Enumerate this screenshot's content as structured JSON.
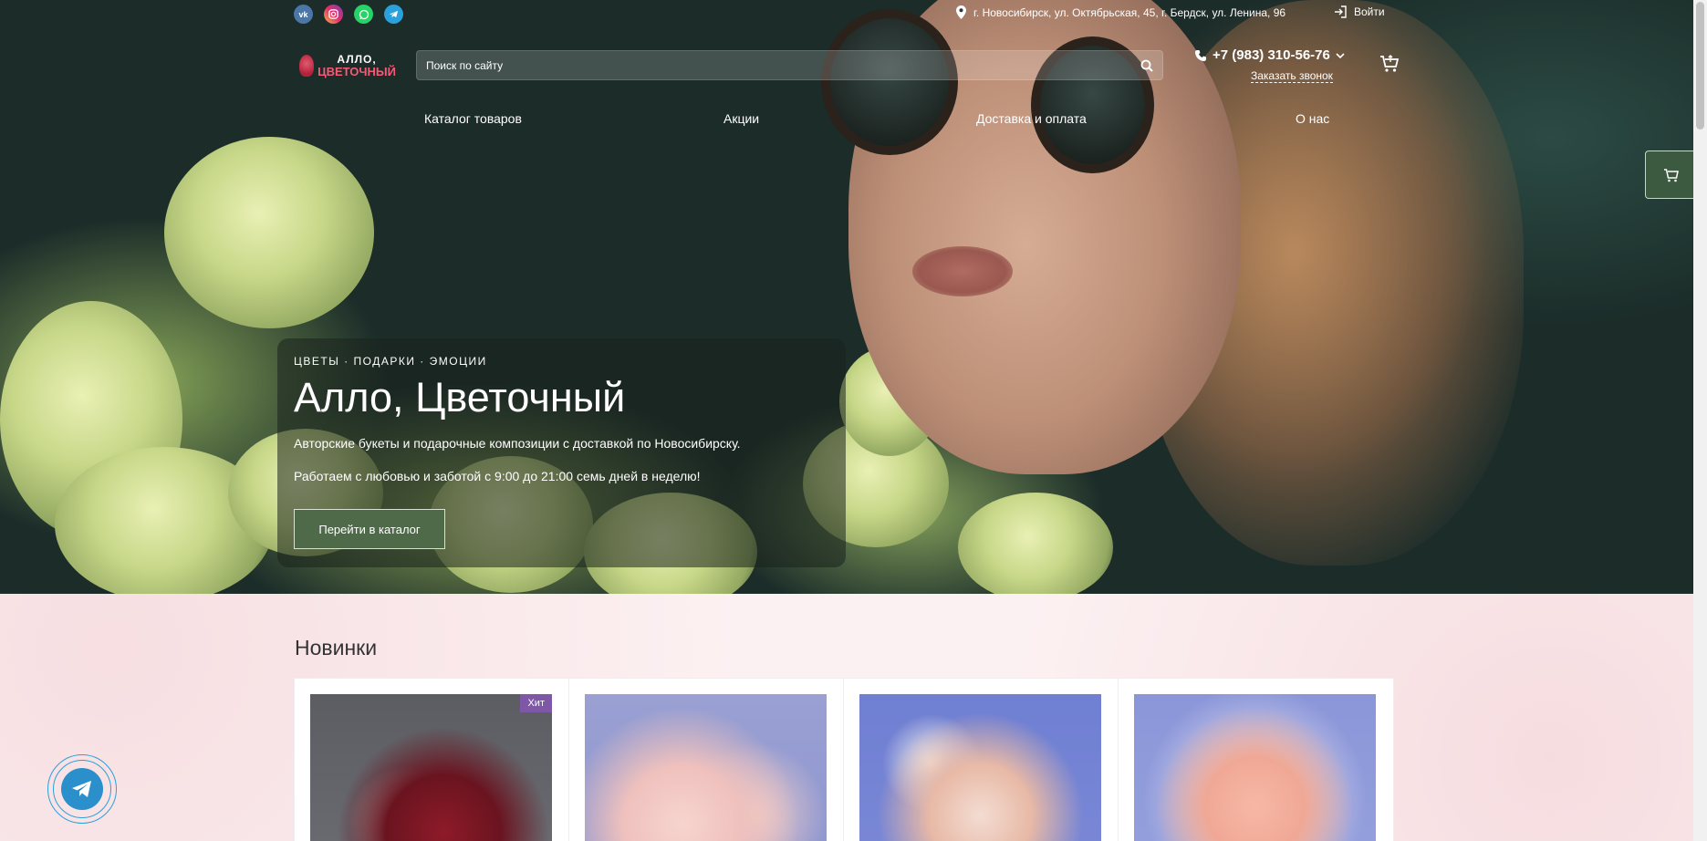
{
  "social": [
    {
      "name": "vk",
      "label": "vk"
    },
    {
      "name": "instagram",
      "label": ""
    },
    {
      "name": "whatsapp",
      "label": ""
    },
    {
      "name": "telegram",
      "label": ""
    }
  ],
  "topbar": {
    "address": "г. Новосибирск, ул. Октябрьская, 45, г. Бердск, ул. Ленина, 96",
    "login": "Войти"
  },
  "logo": {
    "line1": "АЛЛО,",
    "line2": "ЦВЕТОЧНЫЙ"
  },
  "search": {
    "placeholder": "Поиск по сайту"
  },
  "contact": {
    "phone": "+7 (983) 310-56-76",
    "callback": "Заказать звонок"
  },
  "nav": [
    "Каталог товаров",
    "Акции",
    "Доставка и оплата",
    "О нас"
  ],
  "hero": {
    "tagline": "ЦВЕТЫ · ПОДАРКИ · ЭМОЦИИ",
    "title": "Алло, Цветочный",
    "text1": "Авторские букеты и подарочные композиции с доставкой по Новосибирску.",
    "text2": "Работаем с любовью и заботой с 9:00 до 21:00 семь дней в неделю!",
    "button": "Перейти в каталог"
  },
  "section": {
    "title": "Новинки"
  },
  "products": [
    {
      "badge": "Хит"
    },
    {
      "badge": ""
    },
    {
      "badge": ""
    },
    {
      "badge": ""
    }
  ],
  "colors": {
    "accent_green": "#4e6a49",
    "badge_purple": "#7e58a6",
    "telegram": "#2aa1da"
  }
}
